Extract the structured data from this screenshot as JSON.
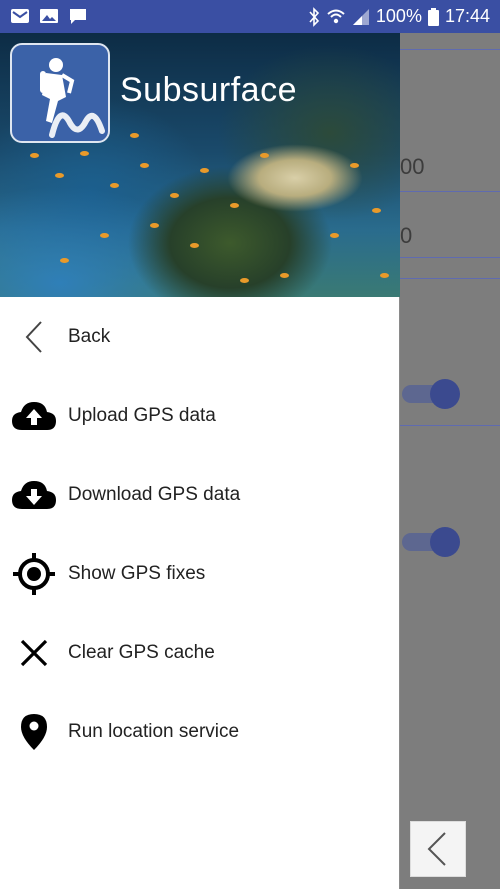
{
  "status_bar": {
    "battery_percent": "100%",
    "time": "17:44"
  },
  "app": {
    "title": "Subsurface"
  },
  "menu": {
    "items": [
      {
        "label": "Back",
        "icon": "chevron-left-icon"
      },
      {
        "label": "Upload GPS data",
        "icon": "cloud-upload-icon"
      },
      {
        "label": "Download GPS data",
        "icon": "cloud-download-icon"
      },
      {
        "label": "Show GPS fixes",
        "icon": "gps-target-icon"
      },
      {
        "label": "Clear GPS cache",
        "icon": "close-icon"
      },
      {
        "label": "Run location service",
        "icon": "location-pin-icon"
      }
    ]
  },
  "background_page": {
    "field_1_value": "00",
    "field_2_value": "0",
    "toggle_1_on": true,
    "toggle_2_on": true
  },
  "colors": {
    "status_bar": "#3a4fa3",
    "accent": "#3b4a8f",
    "logo_bg": "#3b62a8"
  }
}
